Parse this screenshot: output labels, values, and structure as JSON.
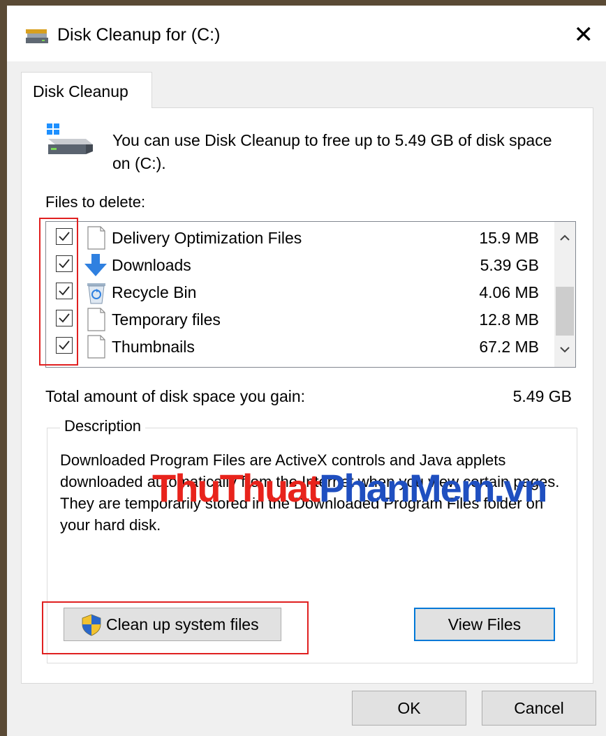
{
  "window": {
    "title": "Disk Cleanup for  (C:)",
    "close_glyph": "✕"
  },
  "tab": {
    "label": "Disk Cleanup"
  },
  "intro": {
    "text": "You can use Disk Cleanup to free up to 5.49 GB of disk space on  (C:)."
  },
  "files_label": "Files to delete:",
  "files": [
    {
      "name": "Delivery Optimization Files",
      "size": "15.9 MB",
      "checked": true,
      "icon": "file-icon"
    },
    {
      "name": "Downloads",
      "size": "5.39 GB",
      "checked": true,
      "icon": "download-arrow-icon"
    },
    {
      "name": "Recycle Bin",
      "size": "4.06 MB",
      "checked": true,
      "icon": "recycle-bin-icon"
    },
    {
      "name": "Temporary files",
      "size": "12.8 MB",
      "checked": true,
      "icon": "file-icon"
    },
    {
      "name": "Thumbnails",
      "size": "67.2 MB",
      "checked": true,
      "icon": "file-icon"
    }
  ],
  "total": {
    "label": "Total amount of disk space you gain:",
    "value": "5.49 GB"
  },
  "description": {
    "legend": "Description",
    "text": "Downloaded Program Files are ActiveX controls and Java applets downloaded automatically from the Internet when you view certain pages. They are temporarily stored in the Downloaded Program Files folder on your hard disk."
  },
  "watermark": {
    "part1": "ThuThuat",
    "part2": "PhanMem.vn"
  },
  "buttons": {
    "cleanup": "Clean up system files",
    "view_files": "View Files",
    "ok": "OK",
    "cancel": "Cancel"
  },
  "colors": {
    "highlight": "#e02020",
    "accent": "#0078d7"
  }
}
